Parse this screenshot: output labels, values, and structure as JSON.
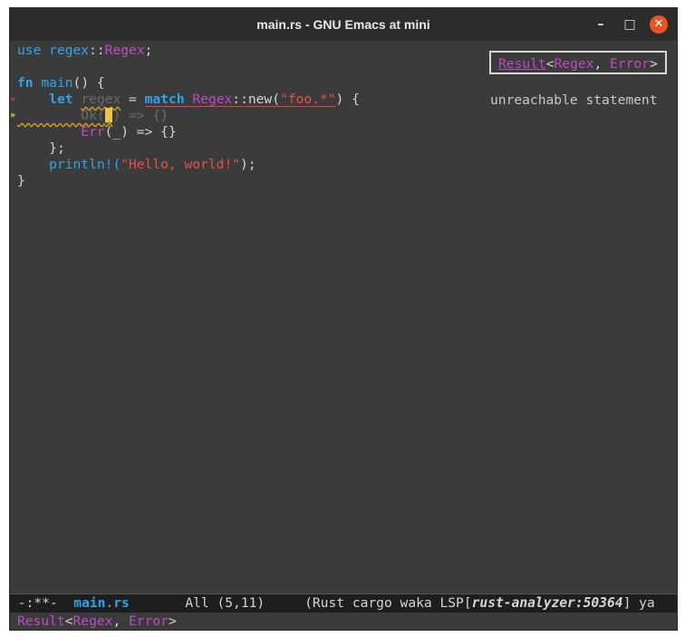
{
  "window": {
    "title": "main.rs - GNU Emacs at mini",
    "minimize_glyph": "–",
    "maximize_glyph": "□",
    "close_glyph": "✕"
  },
  "code": {
    "l1": {
      "use": "use",
      "path": "regex",
      "sep": "::",
      "type": "Regex",
      "end": ";"
    },
    "l3": {
      "fn": "fn",
      "name": "main",
      "rest": "() {"
    },
    "l4": {
      "indent": "    ",
      "let": "let",
      "sp1": " ",
      "var": "regex",
      "eq": " = ",
      "match": "match",
      "sp2": " ",
      "type": "Regex",
      "call": "::new(",
      "str": "\"foo.*\"",
      "end": ") {"
    },
    "l5": {
      "indent": "        ",
      "ok_pre": "Ok(",
      "cursor": "_",
      "ok_post": ") => {}"
    },
    "l6": {
      "indent": "        ",
      "err": "Err",
      "rest": "(_) => {}"
    },
    "l7": {
      "indent": "    ",
      "end": "};"
    },
    "l8": {
      "indent": "    ",
      "macro": "println!(",
      "str": "\"Hello, world!\"",
      "end": ");"
    },
    "l9": {
      "end": "}"
    }
  },
  "fringe": {
    "error_marker": "»",
    "warning_marker": "»"
  },
  "hover": {
    "result": "Result",
    "lt": "<",
    "regex": "Regex",
    "comma": ", ",
    "error": "Error",
    "gt": ">"
  },
  "diagnostic": "unreachable statement",
  "modeline": {
    "state": " -:**-  ",
    "buffer": "main.rs",
    "position": "       All (5,11)     ",
    "modes_pre": "(Rust cargo waka LSP[",
    "lsp": "rust-analyzer:50364",
    "modes_post": "] ya"
  },
  "echo": {
    "result": "Result",
    "lt": "<",
    "regex": "Regex",
    "comma": ", ",
    "error": "Error",
    "gt": ">"
  },
  "colors": {
    "keyword": "#2fa4e8",
    "type": "#c04ac4",
    "string": "#e2524a",
    "background": "#3b3b3b",
    "cursor": "#e8c44a",
    "close_button": "#e95420"
  }
}
